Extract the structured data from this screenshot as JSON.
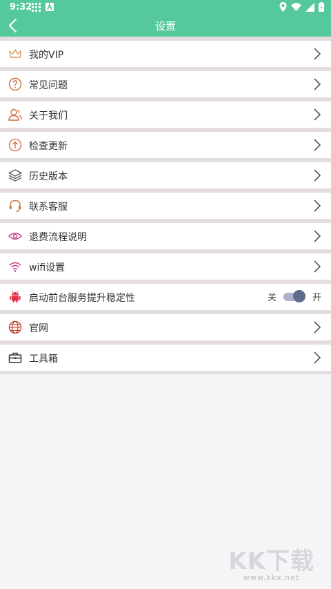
{
  "status_bar": {
    "time": "9:32",
    "icons": [
      "grid-icon",
      "text-a-icon",
      "location-icon",
      "wifi-icon",
      "signal-icon",
      "battery-icon"
    ]
  },
  "app_bar": {
    "title": "设置",
    "background": "#55c99b"
  },
  "settings": {
    "items": [
      {
        "label": "我的VIP",
        "icon": "crown-icon",
        "icon_color": "#d99a66"
      },
      {
        "label": "常见问题",
        "icon": "question-circle-icon",
        "icon_color": "#cc6f3c"
      },
      {
        "label": "关于我们",
        "icon": "users-icon",
        "icon_color": "#cc6f3c"
      },
      {
        "label": "检查更新",
        "icon": "upload-circle-icon",
        "icon_color": "#cc6f3c"
      },
      {
        "label": "历史版本",
        "icon": "layers-icon",
        "icon_color": "#555555"
      },
      {
        "label": "联系客服",
        "icon": "headset-icon",
        "icon_color": "#cc6f3c"
      },
      {
        "label": "退费流程说明",
        "icon": "eye-icon",
        "icon_color": "#c23a8a"
      },
      {
        "label": "wifi设置",
        "icon": "wifi-icon",
        "icon_color": "#c23a8a"
      },
      {
        "label": "启动前台服务提升稳定性",
        "icon": "android-icon",
        "icon_color": "#e0304a"
      },
      {
        "label": "官网",
        "icon": "globe-icon",
        "icon_color": "#c0392b"
      },
      {
        "label": "工具箱",
        "icon": "toolbox-icon",
        "icon_color": "#333333"
      }
    ],
    "toggle": {
      "off_label": "关",
      "on_label": "开",
      "state": "on"
    }
  },
  "watermark": {
    "logo": "KK下载",
    "url": "www.kkx.net"
  }
}
